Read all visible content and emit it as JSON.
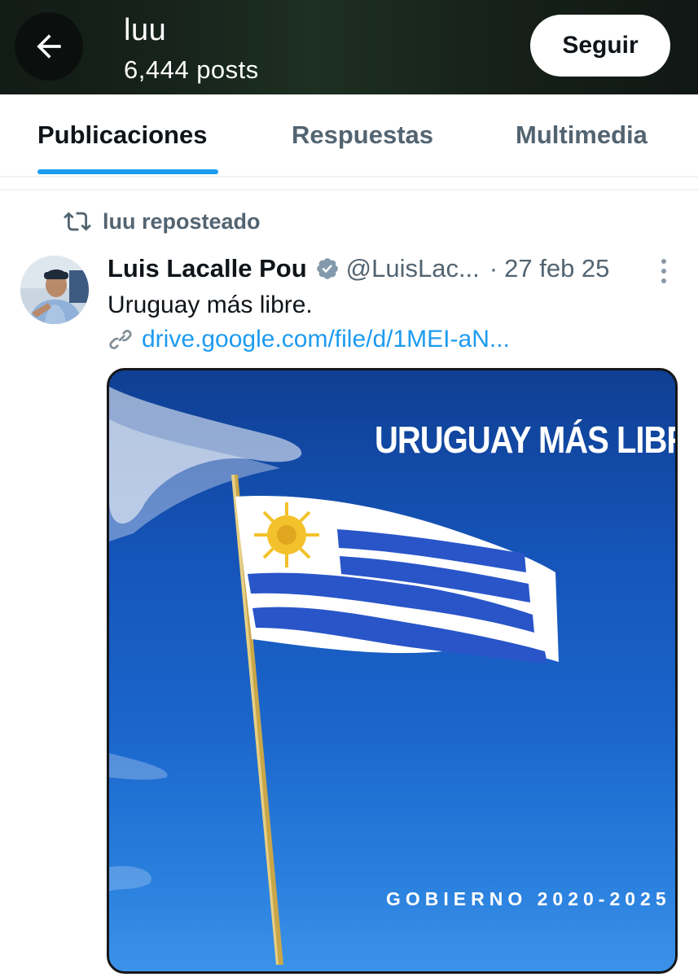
{
  "header": {
    "title": "luu",
    "post_count": "6,444 posts",
    "follow_label": "Seguir",
    "back_icon": "arrow-left-icon"
  },
  "tabs": [
    {
      "label": "Publicaciones",
      "active": true
    },
    {
      "label": "Respuestas",
      "active": false
    },
    {
      "label": "Multimedia",
      "active": false
    }
  ],
  "post": {
    "repost_label": "luu reposteado",
    "author_name": "Luis Lacalle Pou",
    "verified": true,
    "handle": "@LuisLac...",
    "separator": "·",
    "date": "27 feb 25",
    "text": "Uruguay más libre.",
    "link_text": "drive.google.com/file/d/1MEI-aN...",
    "media": {
      "headline": "URUGUAY MÁS LIBRE",
      "footer": "GOBIERNO 2020-2025"
    }
  },
  "colors": {
    "accent": "#1d9bf0",
    "text_primary": "#0f1419",
    "text_secondary": "#536471"
  }
}
